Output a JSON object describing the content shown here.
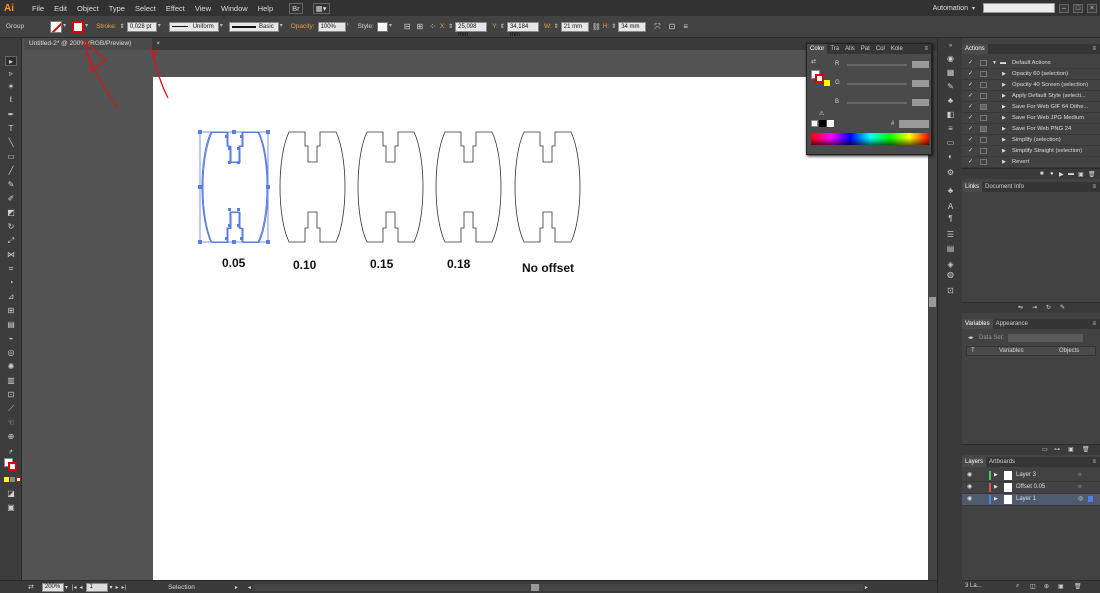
{
  "app": {
    "logo": "Ai",
    "workspace": "Automation"
  },
  "menu": [
    "File",
    "Edit",
    "Object",
    "Type",
    "Select",
    "Effect",
    "View",
    "Window",
    "Help"
  ],
  "control": {
    "selection_type": "Group",
    "stroke_label": "Stroke:",
    "stroke_weight": "0,028 pt",
    "profile": "Uniform",
    "brush": "Basic",
    "opacity_label": "Opacity:",
    "opacity_value": "100%",
    "style_label": "Style:",
    "x_label": "X:",
    "x_value": "25,098 mm",
    "y_label": "Y:",
    "y_value": "34,184 mm",
    "w_label": "W:",
    "w_value": "21 mm",
    "h_label": "H:",
    "h_value": "34 mm"
  },
  "document": {
    "tab_title": "Untitled-2* @ 200% (RGB/Preview)"
  },
  "canvas": {
    "labels": [
      "0.05",
      "0.10",
      "0.15",
      "0.18",
      "No offset"
    ]
  },
  "status": {
    "zoom": "200%",
    "artboard": "1",
    "tool": "Selection"
  },
  "color_panel": {
    "tabs": [
      "Color",
      "Tra",
      "Alis",
      "Pat",
      "Col",
      "Kole"
    ],
    "channels": [
      "R",
      "G",
      "B"
    ],
    "hex_label": "#"
  },
  "actions_panel": {
    "title": "Actions",
    "items": [
      "Default Actions",
      "Opacity 60 (selection)",
      "Opacity 40 Screen (selection)",
      "Apply Default Style (selecti...",
      "Save For Web GIF 64 Dithe...",
      "Save For Web JPG Medium",
      "Save For Web PNG 24",
      "Simplify (selection)",
      "Simplify Straight (selection)",
      "Revert"
    ]
  },
  "links_panel": {
    "tabs": [
      "Links",
      "Document Info"
    ]
  },
  "variables_panel": {
    "tabs": [
      "Variables",
      "Appearance"
    ],
    "dataset_label": "Data Set:",
    "columns": [
      "T",
      "Variables",
      "Objects"
    ]
  },
  "layers_panel": {
    "tabs": [
      "Layers",
      "Artboards"
    ],
    "layers": [
      "Layer 3",
      "Offset 0.05",
      "Layer 1"
    ],
    "layer_colors": [
      "#4fca4f",
      "#e84c3d",
      "#4f7fe8"
    ],
    "footer": "3 La..."
  },
  "icons": {
    "selection-tool": "▸",
    "direct-selection-tool": "▹",
    "magic-wand-tool": "✶",
    "pen-tool": "✒",
    "type-tool": "T",
    "line-tool": "╲",
    "rectangle-tool": "▭",
    "paintbrush-tool": "🖌",
    "pencil-tool": "✎",
    "eraser-tool": "⌫",
    "rotate-tool": "↻",
    "scale-tool": "⤢",
    "hand-tool": "✋",
    "zoom-tool": "🔍"
  }
}
